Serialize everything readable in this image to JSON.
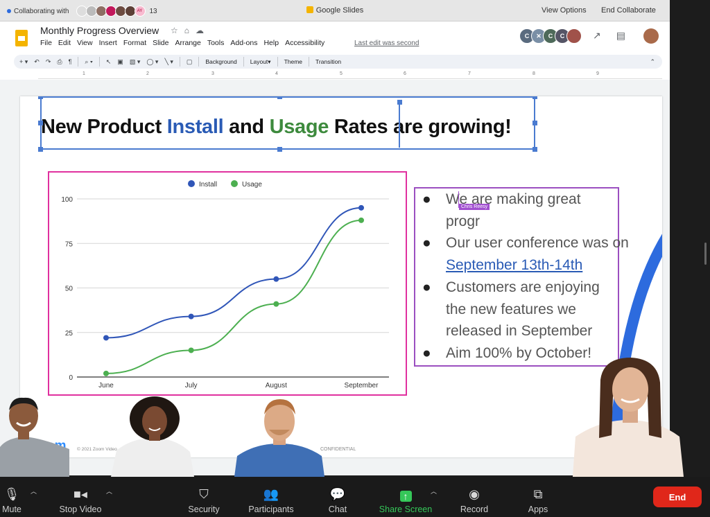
{
  "zoom_top": {
    "collaborating_label": "Collaborating with",
    "collaborator_count": "13",
    "collaborator_initials": "AY",
    "window_title": "Google Slides",
    "view_options": "View Options",
    "end_collaborate": "End Collaborate"
  },
  "slides": {
    "doc_title": "Monthly Progress Overview",
    "menu": [
      "File",
      "Edit",
      "View",
      "Insert",
      "Format",
      "Slide",
      "Arrange",
      "Tools",
      "Add-ons",
      "Help",
      "Accessibility"
    ],
    "last_edit": "Last edit was second",
    "presence_initials": [
      "C",
      "C",
      "C"
    ],
    "toolbar": {
      "background": "Background",
      "layout": "Layout",
      "theme": "Theme",
      "transition": "Transition"
    },
    "ruler_ticks": [
      "1",
      "2",
      "3",
      "4",
      "5",
      "6",
      "7",
      "8",
      "9"
    ]
  },
  "slide": {
    "title_part1": "New Product ",
    "title_install": "Install",
    "title_part2": " and ",
    "title_usage": "Usage",
    "title_part3": " Rates are growing!",
    "bullets": [
      {
        "text": "We are making great progr"
      },
      {
        "text_pre": "Our user conference was on ",
        "link": "September 13th-14th"
      },
      {
        "text": "Customers are enjoying the new features we released in September"
      },
      {
        "text": "Aim 100% by October!"
      }
    ],
    "cursor_tag": "Chris Reesy",
    "footer": "© 2021 Zoom Video",
    "confidential": "CONFIDENTIAL",
    "logo_text": "om"
  },
  "chart_data": {
    "type": "line",
    "categories": [
      "June",
      "July",
      "August",
      "September"
    ],
    "series": [
      {
        "name": "Install",
        "color": "#3056b8",
        "values": [
          22,
          34,
          55,
          95
        ]
      },
      {
        "name": "Usage",
        "color": "#4caf50",
        "values": [
          2,
          15,
          41,
          88
        ]
      }
    ],
    "ylim": [
      0,
      100
    ],
    "yticks": [
      0,
      25,
      50,
      75,
      100
    ],
    "ytick_labels": [
      "0",
      "25",
      "50",
      "75",
      "100"
    ],
    "grid": true,
    "legend": "top-center"
  },
  "bottom_bar": {
    "mute": "Mute",
    "stop_video": "Stop Video",
    "security": "Security",
    "participants": "Participants",
    "chat": "Chat",
    "share_screen": "Share Screen",
    "record": "Record",
    "apps": "Apps",
    "end": "End"
  },
  "colors": {
    "chart_border": "#e0309f",
    "bullets_border": "#9b4fc0",
    "selection": "#4a7bd0",
    "end_button": "#e0271a",
    "share_green": "#35c759"
  }
}
